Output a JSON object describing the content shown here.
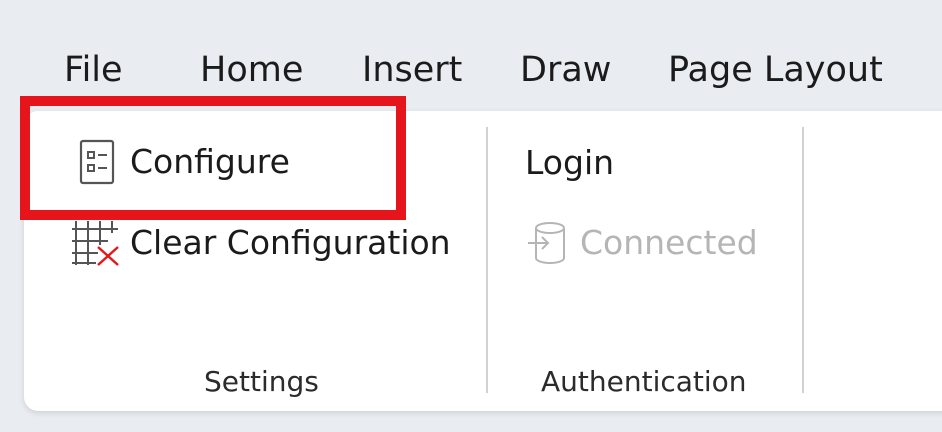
{
  "tabs": [
    {
      "label": "File"
    },
    {
      "label": "Home"
    },
    {
      "label": "Insert"
    },
    {
      "label": "Draw"
    },
    {
      "label": "Page Layout"
    }
  ],
  "ribbon": {
    "settings": {
      "group_label": "Settings",
      "configure_label": "Configure",
      "clear_configuration_label": "Clear Configuration"
    },
    "authentication": {
      "group_label": "Authentication",
      "login_label": "Login",
      "connected_label": "Connected"
    }
  },
  "colors": {
    "highlight": "#e5151b",
    "disabled_text": "#b5b5b5",
    "clear_x": "#e5151b"
  },
  "icons": {
    "configure": "checklist-icon",
    "clear_configuration": "table-clear-icon",
    "connected": "database-arrow-icon"
  }
}
